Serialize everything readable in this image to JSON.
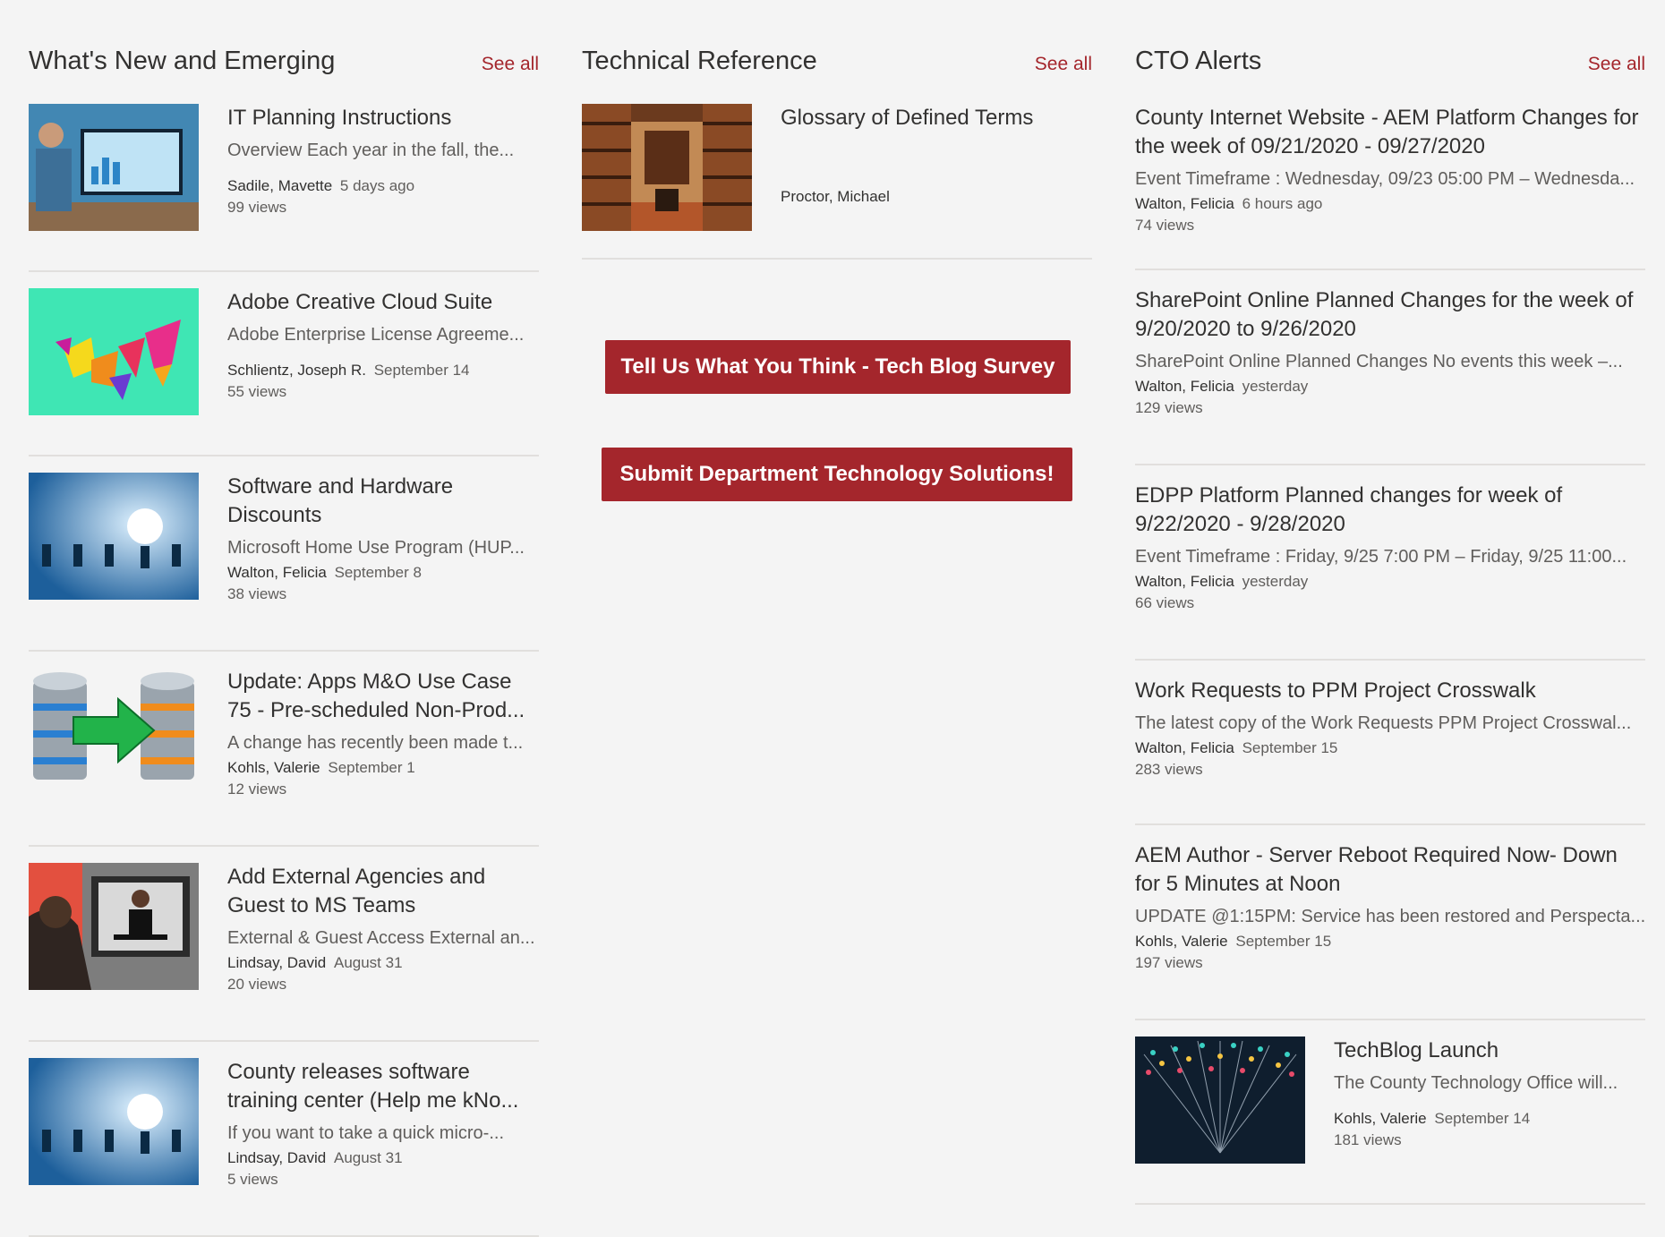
{
  "columns": [
    {
      "title": "What's New and Emerging",
      "see_all": "See all",
      "items": [
        {
          "title": "IT Planning Instructions",
          "desc": "Overview Each year in the fall, the...",
          "author": "Sadile, Mavette",
          "date": "5 days ago",
          "views": "99 views",
          "image": "person-at-computer-dashboard"
        },
        {
          "title": "Adobe Creative Cloud Suite",
          "desc": "Adobe Enterprise License Agreeme...",
          "author": "Schlientz, Joseph R.",
          "date": "September 14",
          "views": "55 views",
          "image": "colorful-geometric-shapes"
        },
        {
          "title": "Software and Hardware Discounts",
          "desc": "Microsoft Home Use Program (HUP...",
          "author": "Walton, Felicia",
          "date": "September 8",
          "views": "38 views",
          "image": "light-bulbs"
        },
        {
          "title": "Update: Apps M&O Use Case 75 - Pre-scheduled Non-Prod...",
          "desc": "A change has recently been made t...",
          "author": "Kohls, Valerie",
          "date": "September 1",
          "views": "12 views",
          "image": "database-transfer"
        },
        {
          "title": "Add External Agencies and Guest to MS Teams",
          "desc": "External & Guest Access External an...",
          "author": "Lindsay, David",
          "date": "August 31",
          "views": "20 views",
          "image": "video-conference"
        },
        {
          "title": "County releases software training center (Help me kNo...",
          "desc": "If you want to take a quick micro-...",
          "author": "Lindsay, David",
          "date": "August 31",
          "views": "5 views",
          "image": "light-bulbs"
        }
      ]
    },
    {
      "title": "Technical Reference",
      "see_all": "See all",
      "items": [
        {
          "title": "Glossary of Defined Terms",
          "author": "Proctor, Michael",
          "image": "library-room"
        }
      ],
      "buttons": [
        "Tell Us What You Think - Tech Blog Survey",
        "Submit Department Technology Solutions!"
      ]
    },
    {
      "title": "CTO Alerts",
      "see_all": "See all",
      "items": [
        {
          "title": "County Internet Website - AEM Platform Changes for the week of 09/21/2020 - 09/27/2020",
          "desc": "Event Timeframe : Wednesday, 09/23 05:00 PM – Wednesda...",
          "author": "Walton, Felicia",
          "date": "6 hours ago",
          "views": "74 views"
        },
        {
          "title": "SharePoint Online Planned Changes for the week of 9/20/2020 to 9/26/2020",
          "desc": " SharePoint Online Planned Changes No events this week –...",
          "author": "Walton, Felicia",
          "date": "yesterday",
          "views": "129 views"
        },
        {
          "title": "EDPP Platform Planned changes for week of 9/22/2020 - 9/28/2020",
          "desc": "Event Timeframe : Friday, 9/25 7:00 PM – Friday, 9/25 11:00...",
          "author": "Walton, Felicia",
          "date": "yesterday",
          "views": "66 views"
        },
        {
          "title": "Work Requests to PPM Project Crosswalk",
          "desc": "The latest copy of the Work Requests PPM Project Crosswal...",
          "author": "Walton, Felicia",
          "date": "September 15",
          "views": "283 views"
        },
        {
          "title": "AEM Author - Server Reboot Required Now- Down for 5 Minutes at Noon",
          "desc": "UPDATE @1:15PM: Service has been restored and Perspecta...",
          "author": "Kohls, Valerie",
          "date": "September 15",
          "views": "197 views"
        },
        {
          "title": "TechBlog Launch",
          "desc": "The County Technology Office will...",
          "author": "Kohls, Valerie",
          "date": "September 14",
          "views": "181 views",
          "image": "fiber-optic-strands"
        }
      ]
    }
  ],
  "colors": {
    "accent": "#a4262c",
    "background": "#f4f4f4",
    "divider": "#e1dfdd"
  }
}
